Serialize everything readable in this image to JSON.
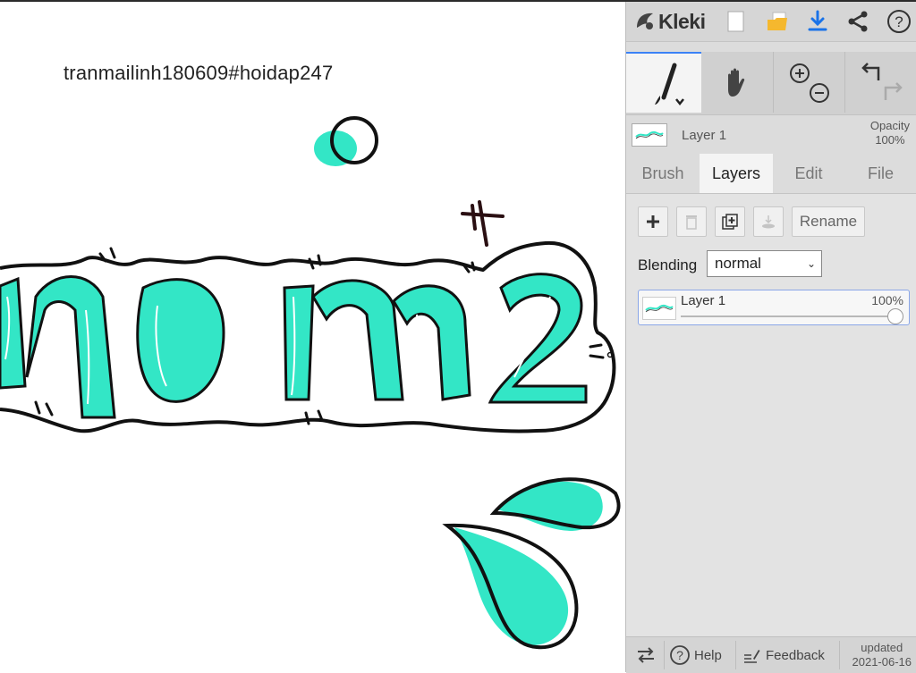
{
  "canvas": {
    "caption": "tranmailinh180609#hoidap247",
    "stroke_color": "#111111",
    "fill_color": "#33e6c6"
  },
  "topbar": {
    "app_name": "Kleki",
    "icons": [
      "logo-icon",
      "new-file-icon",
      "open-folder-icon",
      "download-icon",
      "share-icon",
      "help-icon"
    ],
    "accent": "#1a73e8"
  },
  "toolbar": {
    "tools": [
      "brush-icon",
      "hand-icon",
      "zoom-in-icon",
      "zoom-out-icon",
      "undo-icon",
      "redo-icon"
    ]
  },
  "layer_status": {
    "name": "Layer 1",
    "opacity_label": "Opacity",
    "opacity_value": "100%"
  },
  "tabs": [
    {
      "label": "Brush",
      "active": false
    },
    {
      "label": "Layers",
      "active": true
    },
    {
      "label": "Edit",
      "active": false
    },
    {
      "label": "File",
      "active": false
    }
  ],
  "layers_panel": {
    "rename_label": "Rename",
    "blending_label": "Blending",
    "blending_value": "normal",
    "layers": [
      {
        "name": "Layer 1",
        "opacity": "100%",
        "opacity_fraction": 1.0
      }
    ]
  },
  "footer": {
    "help_label": "Help",
    "feedback_label": "Feedback",
    "updated_label": "updated",
    "updated_date": "2021-06-16"
  }
}
